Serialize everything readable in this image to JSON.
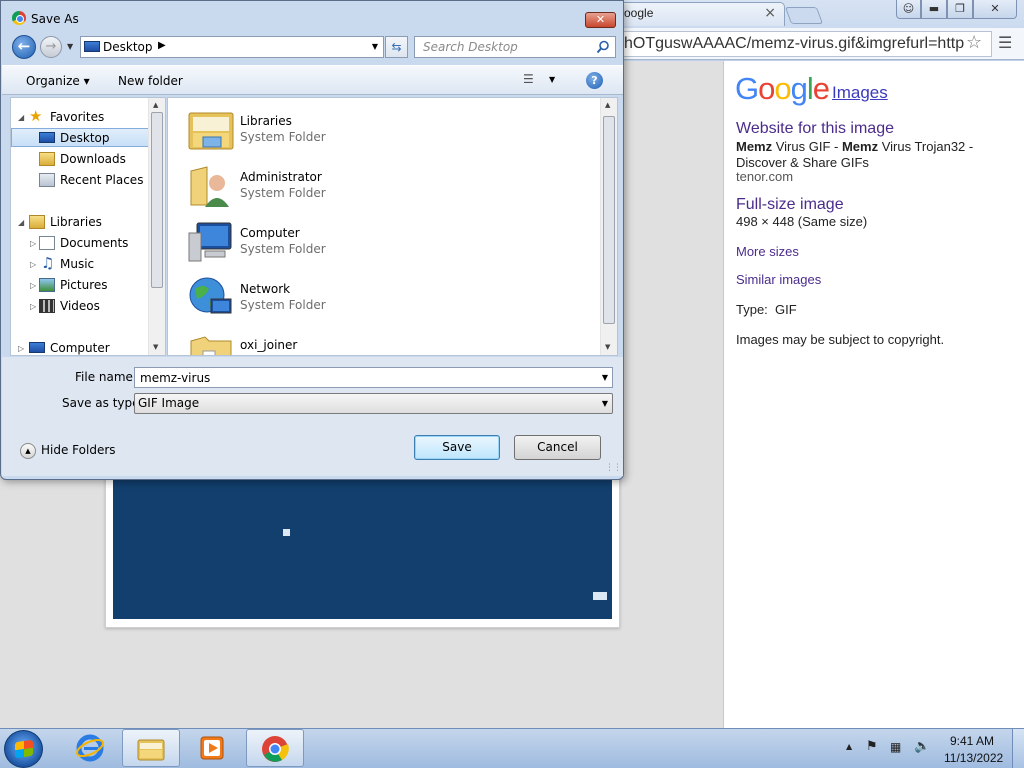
{
  "browser": {
    "tab_title": "oogle",
    "tab_close": "×",
    "url_text": "hOTguswAAAAC/memz-virus.gif&imgrefurl=http",
    "panel": {
      "logo_letters": [
        {
          "ch": "G",
          "color": "#4285f4"
        },
        {
          "ch": "o",
          "color": "#ea4335"
        },
        {
          "ch": "o",
          "color": "#fbbc05"
        },
        {
          "ch": "g",
          "color": "#4285f4"
        },
        {
          "ch": "l",
          "color": "#34a853"
        },
        {
          "ch": "e",
          "color": "#ea4335"
        }
      ],
      "images_link": "Images",
      "website_title": "Website for this image",
      "desc_b1": "Memz",
      "desc_t1": " Virus GIF - ",
      "desc_b2": "Memz",
      "desc_t2": " Virus Trojan32 -",
      "desc_line2": "Discover & Share GIFs",
      "source": "tenor.com",
      "fullsize_title": "Full-size image",
      "dimensions": "498 × 448 (Same size)",
      "more_sizes": "More sizes",
      "similar_images": "Similar images",
      "type_label": "Type:",
      "type_value": "GIF",
      "copyright": "Images may be subject to copyright."
    }
  },
  "dialog": {
    "title": "Save As",
    "address_location": "Desktop",
    "search_placeholder": "Search Desktop",
    "organize_label": "Organize",
    "new_folder_label": "New folder",
    "nav": {
      "favorites": "Favorites",
      "desktop": "Desktop",
      "downloads": "Downloads",
      "recent_places": "Recent Places",
      "libraries": "Libraries",
      "documents": "Documents",
      "music": "Music",
      "pictures": "Pictures",
      "videos": "Videos",
      "computer": "Computer"
    },
    "files": [
      {
        "name": "Libraries",
        "type": "System Folder"
      },
      {
        "name": "Administrator",
        "type": "System Folder"
      },
      {
        "name": "Computer",
        "type": "System Folder"
      },
      {
        "name": "Network",
        "type": "System Folder"
      },
      {
        "name": "oxi_joiner",
        "type": ""
      }
    ],
    "file_name_label": "File name:",
    "file_name_value": "memz-virus",
    "save_type_label": "Save as type:",
    "save_type_value": "GIF Image",
    "hide_folders_label": "Hide Folders",
    "save_label": "Save",
    "cancel_label": "Cancel"
  },
  "taskbar": {
    "time": "9:41 AM",
    "date": "11/13/2022"
  }
}
